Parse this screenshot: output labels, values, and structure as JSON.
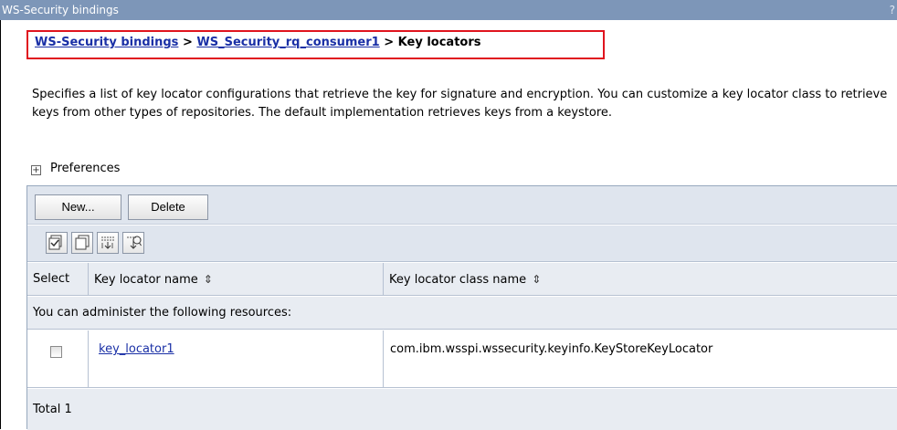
{
  "window": {
    "title": "WS-Security bindings",
    "help": "?"
  },
  "breadcrumb": {
    "items": [
      "WS-Security bindings",
      "WS_Security_rq_consumer1"
    ],
    "separator": ">",
    "current": "Key locators"
  },
  "description": "Specifies a list of key locator configurations that retrieve the key for signature and encryption. You can customize a key locator class to retrieve keys from other types of repositories. The default implementation retrieves keys from a keystore.",
  "preferences": {
    "expand_symbol": "+",
    "label": "Preferences"
  },
  "toolbar": {
    "new_label": "New...",
    "delete_label": "Delete"
  },
  "icon_toolbar": [
    "select-all-icon",
    "deselect-all-icon",
    "show-filter-icon",
    "clear-filter-icon"
  ],
  "table": {
    "columns": [
      "Select",
      "Key locator name",
      "Key locator class name"
    ],
    "sort_symbol": "⇕",
    "admin_note": "You can administer the following resources:",
    "rows": [
      {
        "checked": false,
        "name": "key_locator1",
        "class_name": "com.ibm.wsspi.wssecurity.keyinfo.KeyStoreKeyLocator"
      }
    ],
    "total_text": "Total 1"
  },
  "colors": {
    "title_bar": "#7d96b8",
    "highlight_border": "#e0141e",
    "link": "#1a30a6",
    "panel_bg": "#dfe5ee"
  }
}
